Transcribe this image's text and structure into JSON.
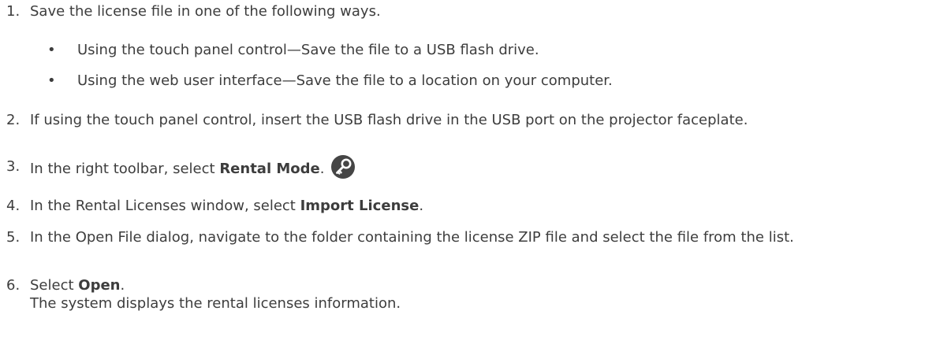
{
  "steps": [
    {
      "num": "1.",
      "text": "Save the license file in one of the following ways."
    },
    {
      "num": "2.",
      "text": "If using the touch panel control, insert the USB flash drive in the USB port on the projector faceplate."
    },
    {
      "num": "3.",
      "pre": "In the right toolbar, select ",
      "bold": "Rental Mode",
      "post": "."
    },
    {
      "num": "4.",
      "pre": "In the Rental Licenses window, select ",
      "bold": "Import License",
      "post": "."
    },
    {
      "num": "5.",
      "text": "In the Open File dialog, navigate to the folder containing the license ZIP file and select the file from the list."
    },
    {
      "num": "6.",
      "pre": "Select ",
      "bold": "Open",
      "post": ".",
      "result": "The system displays the rental licenses information."
    }
  ],
  "bullets": [
    "Using the touch panel control—Save the file to a USB flash drive.",
    "Using the web user interface—Save the file to a location on your computer."
  ],
  "icons": {
    "rental_mode": "key-icon"
  },
  "colors": {
    "text": "#3d3d3d",
    "icon_bg": "#454545"
  }
}
